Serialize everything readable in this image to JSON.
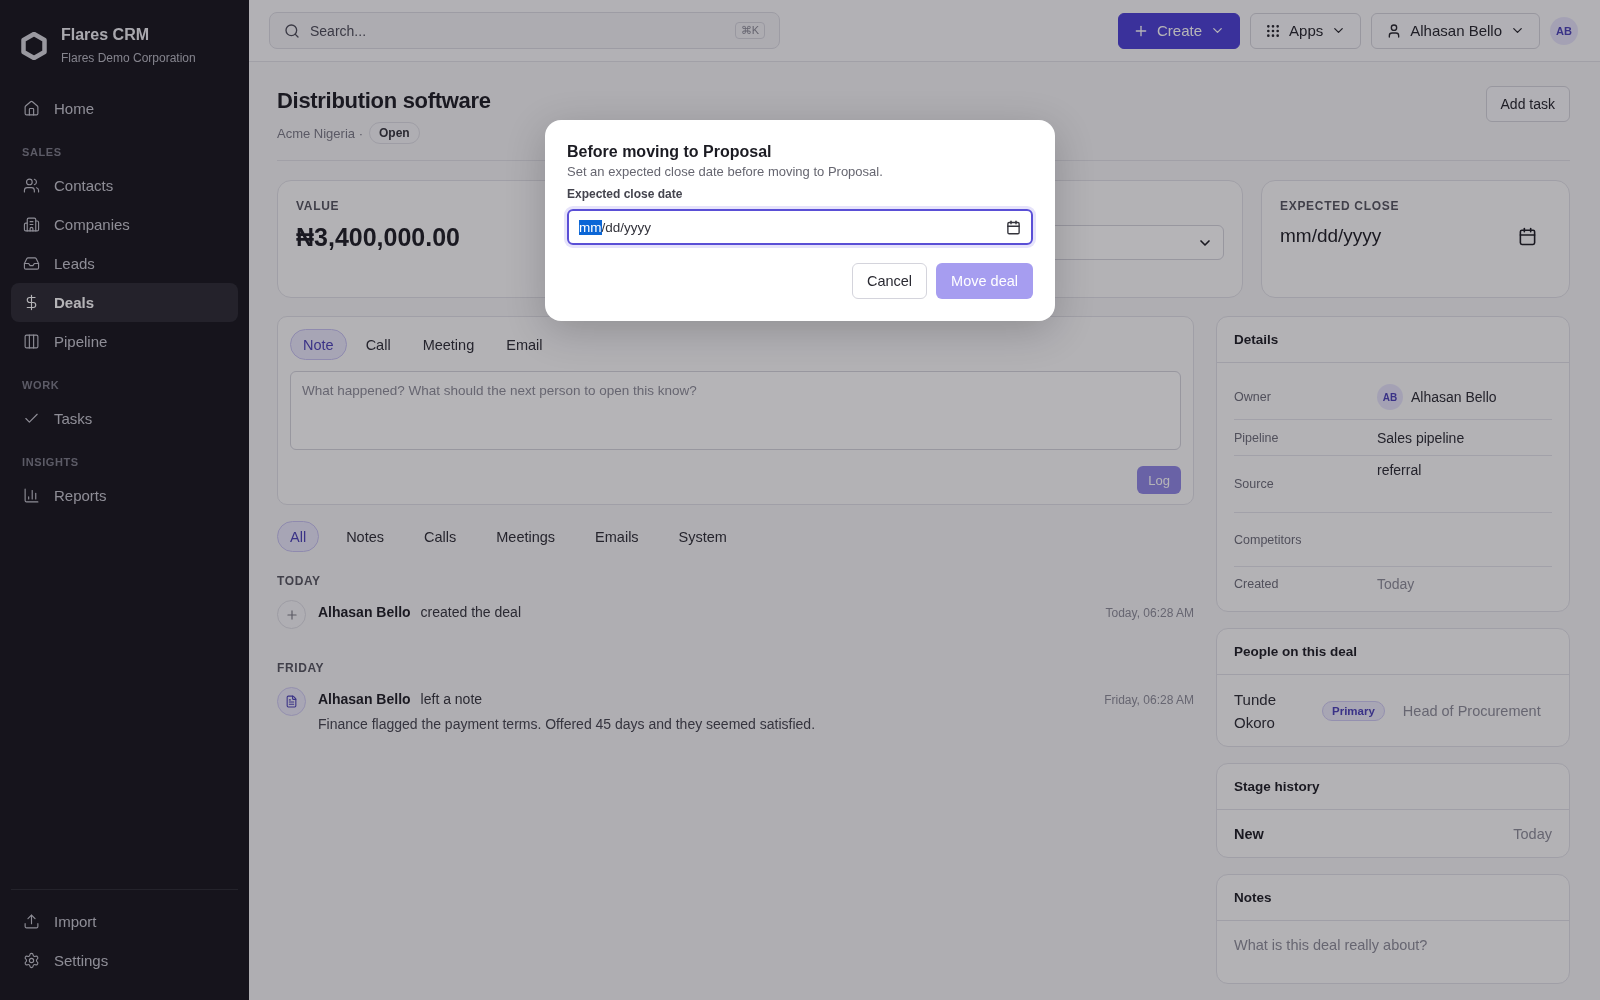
{
  "sidebar": {
    "brand": {
      "name": "Flares CRM",
      "org": "Flares Demo Corporation"
    },
    "groups": [
      {
        "items": [
          {
            "label": "Home",
            "kind": "home",
            "selected": false
          }
        ]
      },
      {
        "title": "SALES",
        "items": [
          {
            "label": "Contacts",
            "kind": "contacts",
            "selected": false
          },
          {
            "label": "Companies",
            "kind": "companies",
            "selected": false
          },
          {
            "label": "Leads",
            "kind": "leads",
            "selected": false
          },
          {
            "label": "Deals",
            "kind": "deals",
            "selected": true
          },
          {
            "label": "Pipeline",
            "kind": "pipeline",
            "selected": false
          }
        ]
      },
      {
        "title": "WORK",
        "items": [
          {
            "label": "Tasks",
            "kind": "tasks",
            "selected": false
          }
        ]
      },
      {
        "title": "INSIGHTS",
        "items": [
          {
            "label": "Reports",
            "kind": "reports",
            "selected": false
          }
        ]
      }
    ],
    "footer": [
      {
        "label": "Import",
        "kind": "import"
      },
      {
        "label": "Settings",
        "kind": "settings"
      }
    ]
  },
  "topbar": {
    "search": {
      "placeholder": "Search...",
      "shortcut": "⌘K"
    },
    "create": "Create",
    "apps": "Apps",
    "user": "Alhasan Bello",
    "avatar": "AB"
  },
  "deal": {
    "title": "Distribution software",
    "company": "Acme Nigeria ·",
    "status": "Open",
    "add_task": "Add task"
  },
  "stats": {
    "value": {
      "label": "VALUE",
      "amount": "₦3,400,000.00"
    },
    "expected_close": {
      "label": "EXPECTED CLOSE",
      "placeholder": "mm/dd/yyyy"
    }
  },
  "composer": {
    "tabs": [
      {
        "label": "Note",
        "selected": true
      },
      {
        "label": "Call",
        "selected": false
      },
      {
        "label": "Meeting",
        "selected": false
      },
      {
        "label": "Email",
        "selected": false
      }
    ],
    "placeholder": "What happened? What should the next person to open this know?",
    "log": "Log",
    "log_disabled": true
  },
  "timeline": {
    "filters": [
      {
        "label": "All",
        "selected": true
      },
      {
        "label": "Notes",
        "selected": false
      },
      {
        "label": "Calls",
        "selected": false
      },
      {
        "label": "Meetings",
        "selected": false
      },
      {
        "label": "Emails",
        "selected": false
      },
      {
        "label": "System",
        "selected": false
      }
    ],
    "groups": [
      {
        "day": "TODAY",
        "events": [
          {
            "kind": "system",
            "actor": "Alhasan Bello",
            "action": "created the deal",
            "time": "Today, 06:28 AM"
          }
        ]
      },
      {
        "day": "FRIDAY",
        "events": [
          {
            "kind": "note",
            "actor": "Alhasan Bello",
            "action": "left a note",
            "time": "Friday, 06:28 AM",
            "body": "Finance flagged the payment terms. Offered 45 days and they seemed satisfied."
          }
        ]
      }
    ]
  },
  "details": {
    "title": "Details",
    "rows": [
      {
        "kind": "person",
        "label": "Owner",
        "value": "Alhasan Bello",
        "avatar": "AB"
      },
      {
        "kind": "text",
        "label": "Pipeline",
        "value": "Sales pipeline"
      },
      {
        "kind": "input",
        "label": "Source",
        "value": "referral"
      },
      {
        "kind": "input",
        "label": "Competitors"
      },
      {
        "kind": "date",
        "label": "Created",
        "value": "Today"
      }
    ]
  },
  "people": {
    "title": "People on this deal",
    "people": [
      {
        "name": "Tunde Okoro",
        "badge": "Primary",
        "role": "Head of Procurement"
      }
    ]
  },
  "stage_history": {
    "title": "Stage history",
    "entries": [
      {
        "stage": "New",
        "date": "Today"
      }
    ]
  },
  "notes": {
    "title": "Notes",
    "placeholder": "What is this deal really about?"
  },
  "modal": {
    "title": "Before moving to Proposal",
    "description": "Set an expected close date before moving to Proposal.",
    "field": {
      "label": "Expected close date",
      "separator": "/",
      "segments": [
        {
          "text": "mm",
          "selected": true
        },
        {
          "text": "dd",
          "selected": false
        },
        {
          "text": "yyyy",
          "selected": false
        }
      ]
    },
    "cancel": "Cancel",
    "confirm": "Move deal",
    "confirm_disabled": true
  }
}
